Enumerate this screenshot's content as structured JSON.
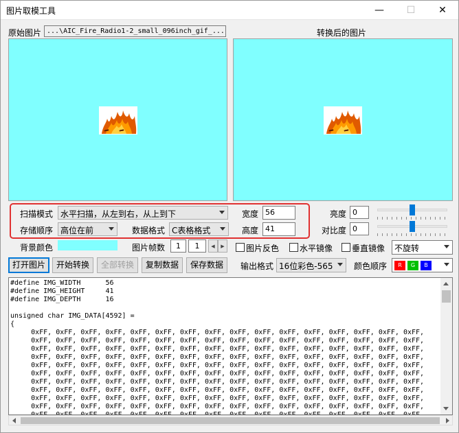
{
  "window": {
    "title": "图片取模工具",
    "min_glyph": "—",
    "max_glyph": "☐",
    "close_glyph": "✕"
  },
  "source": {
    "label": "原始图片",
    "path": "...\\AIC_Fire_Radio1-2_small_096inch_gif_..."
  },
  "converted": {
    "label": "转换后的图片"
  },
  "preview_bg": "#80ffff",
  "settings": {
    "scan_mode_label": "扫描模式",
    "scan_mode_value": "水平扫描，从左到右，从上到下",
    "width_label": "宽度",
    "width_value": "56",
    "storage_order_label": "存储顺序",
    "storage_order_value": "高位在前",
    "data_format_label": "数据格式",
    "data_format_value": "C表格格式",
    "height_label": "高度",
    "height_value": "41"
  },
  "adjust": {
    "brightness_label": "亮度",
    "brightness_value": "0",
    "brightness_level": 0.5,
    "contrast_label": "对比度",
    "contrast_value": "0",
    "contrast_level": 0.5
  },
  "options": {
    "bg_color_label": "背景颜色",
    "bg_color": "#80ffff",
    "frames_label": "图片帧数",
    "frame_current": "1",
    "frame_total": "1",
    "invert_label": "图片反色",
    "hmirror_label": "水平镜像",
    "vmirror_label": "垂直镜像",
    "rotate_value": "不旋转"
  },
  "buttons": {
    "open": "打开图片",
    "start": "开始转换",
    "convert_all": "全部转换",
    "copy": "复制数据",
    "save": "保存数据"
  },
  "output": {
    "format_label": "输出格式",
    "format_value": "16位彩色-565",
    "color_order_label": "颜色顺序",
    "order": [
      "R",
      "G",
      "B"
    ],
    "order_colors": [
      "#ff0000",
      "#00c000",
      "#0000ff"
    ]
  },
  "code": {
    "lines": [
      "#define IMG_WIDTH      56",
      "#define IMG_HEIGHT     41",
      "#define IMG_DEPTH      16",
      "",
      "unsigned char IMG_DATA[4592] =",
      "{",
      "     0xFF, 0xFF, 0xFF, 0xFF, 0xFF, 0xFF, 0xFF, 0xFF, 0xFF, 0xFF, 0xFF, 0xFF, 0xFF, 0xFF, 0xFF, 0xFF,",
      "     0xFF, 0xFF, 0xFF, 0xFF, 0xFF, 0xFF, 0xFF, 0xFF, 0xFF, 0xFF, 0xFF, 0xFF, 0xFF, 0xFF, 0xFF, 0xFF,",
      "     0xFF, 0xFF, 0xFF, 0xFF, 0xFF, 0xFF, 0xFF, 0xFF, 0xFF, 0xFF, 0xFF, 0xFF, 0xFF, 0xFF, 0xFF, 0xFF,",
      "     0xFF, 0xFF, 0xFF, 0xFF, 0xFF, 0xFF, 0xFF, 0xFF, 0xFF, 0xFF, 0xFF, 0xFF, 0xFF, 0xFF, 0xFF, 0xFF,",
      "     0xFF, 0xFF, 0xFF, 0xFF, 0xFF, 0xFF, 0xFF, 0xFF, 0xFF, 0xFF, 0xFF, 0xFF, 0xFF, 0xFF, 0xFF, 0xFF,",
      "     0xFF, 0xFF, 0xFF, 0xFF, 0xFF, 0xFF, 0xFF, 0xFF, 0xFF, 0xFF, 0xFF, 0xFF, 0xFF, 0xFF, 0xFF, 0xFF,",
      "     0xFF, 0xFF, 0xFF, 0xFF, 0xFF, 0xFF, 0xFF, 0xFF, 0xFF, 0xFF, 0xFF, 0xFF, 0xFF, 0xFF, 0xFF, 0xFF,",
      "     0xFF, 0xFF, 0xFF, 0xFF, 0xFF, 0xFF, 0xFF, 0xFF, 0xFF, 0xFF, 0xFF, 0xFF, 0xFF, 0xFF, 0xFF, 0xFF,",
      "     0xFF, 0xFF, 0xFF, 0xFF, 0xFF, 0xFF, 0xFF, 0xFF, 0xFF, 0xFF, 0xFF, 0xFF, 0xFF, 0xFF, 0xFF, 0xFF,",
      "     0xFF, 0xFF, 0xFF, 0xFF, 0xFF, 0xFF, 0xFF, 0xFF, 0xFF, 0xFF, 0xFF, 0xFF, 0xFF, 0xFF, 0xFF, 0xFF,",
      "     0xFF, 0xFF, 0xFF, 0xFF, 0xFF, 0xFF, 0xFF, 0xFF, 0xFF, 0xFF, 0xFF, 0xFF, 0xFF, 0xFF, 0xFF, 0xFF,",
      "     0xFF, 0xFF, 0xFF, 0xFF, 0xFF, 0xFF, 0xFF, 0xFF, 0xFF, 0xFF, 0xFF, 0xFF, 0xFF, 0xFF, 0xFF, 0xFF,"
    ]
  }
}
